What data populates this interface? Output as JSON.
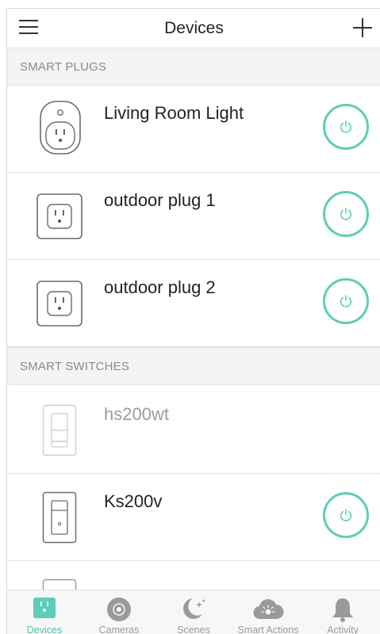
{
  "header": {
    "title": "Devices"
  },
  "sections": {
    "smart_plugs": "SMART PLUGS",
    "smart_switches": "SMART SWITCHES"
  },
  "devices": [
    {
      "name": "Living Room Light",
      "type": "smart-plug-round",
      "online": true
    },
    {
      "name": "outdoor plug 1",
      "type": "outdoor-plug",
      "online": true
    },
    {
      "name": "outdoor plug 2",
      "type": "outdoor-plug",
      "online": true
    },
    {
      "name": "hs200wt",
      "type": "wall-switch",
      "online": false
    },
    {
      "name": "Ks200v",
      "type": "wall-switch",
      "online": true
    }
  ],
  "tabs": [
    {
      "label": "Devices",
      "icon": "plug-icon",
      "active": true
    },
    {
      "label": "Cameras",
      "icon": "camera-icon",
      "active": false
    },
    {
      "label": "Scenes",
      "icon": "moon-stars-icon",
      "active": false
    },
    {
      "label": "Smart Actions",
      "icon": "cloud-sun-icon",
      "active": false
    },
    {
      "label": "Activity",
      "icon": "bell-icon",
      "active": false
    }
  ],
  "colors": {
    "accent": "#5ecdb7",
    "section_bg": "#f4f4f4",
    "inactive": "#9a9a9a"
  }
}
